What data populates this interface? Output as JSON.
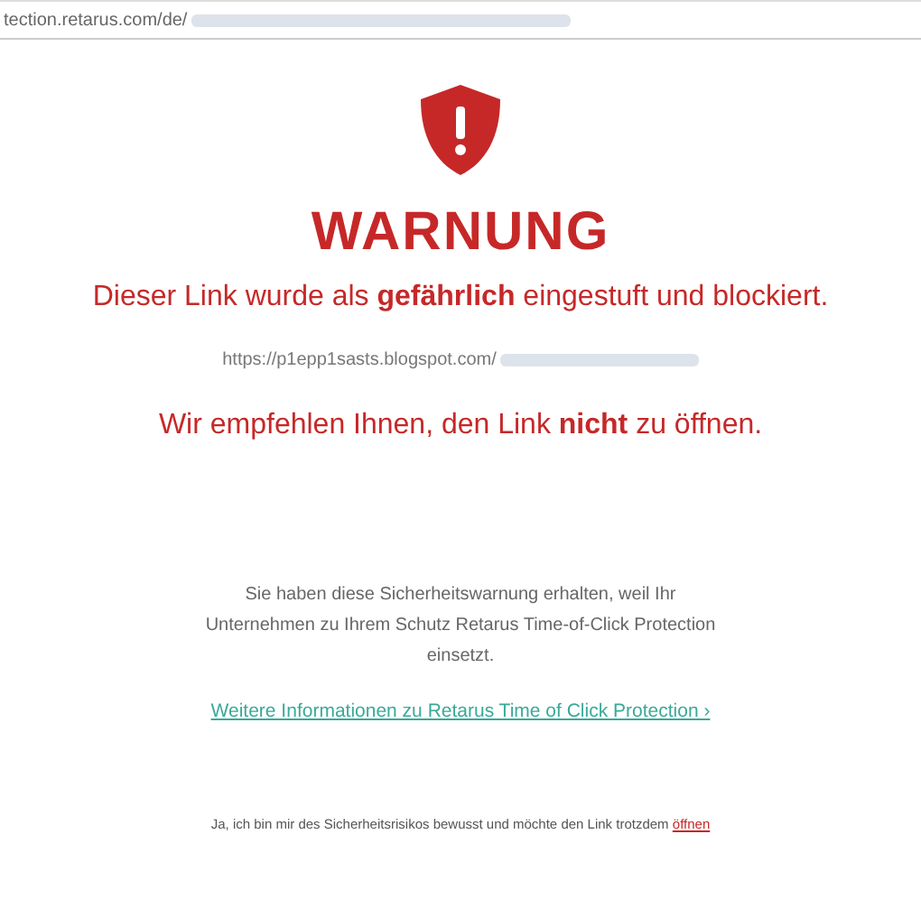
{
  "address_bar": {
    "url": "tection.retarus.com/de/"
  },
  "heading": "WARNUNG",
  "message": "Dieser Link wurde als **gefährlich** eingestuft und blockiert.",
  "blocked_url": "https://p1epp1sasts.blogspot.com/",
  "recommendation": "Wir empfehlen Ihnen, den Link **nicht** zu öffnen.",
  "info": "Sie haben diese Sicherheitswarnung erhalten, weil Ihr Unternehmen zu Ihrem Schutz Retarus Time-of-Click Protection einsetzt.",
  "info_link": "Weitere Informationen zu Retarus Time of Click Protection ›",
  "confirm": {
    "text": "Ja, ich bin mir des Sicherheitsrisikos bewusst und möchte den Link trotzdem",
    "link": "öffnen"
  }
}
